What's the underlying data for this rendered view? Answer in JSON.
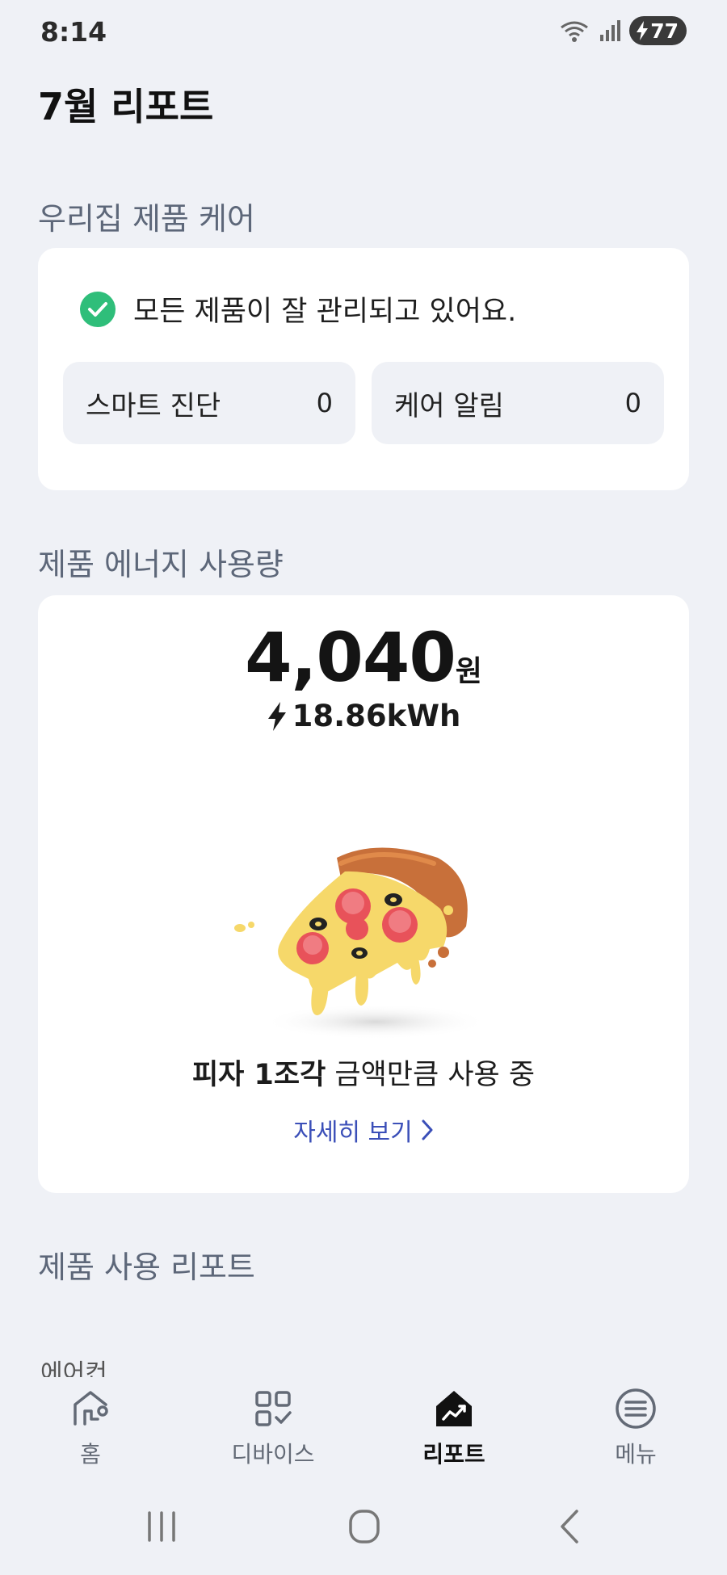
{
  "status_bar": {
    "time": "8:14",
    "battery": "77"
  },
  "page_title": "7월 리포트",
  "care_section": {
    "title": "우리집 제품 케어",
    "status_text": "모든 제품이 잘 관리되고 있어요.",
    "tiles": [
      {
        "label": "스마트 진단",
        "count": "0"
      },
      {
        "label": "케어 알림",
        "count": "0"
      }
    ]
  },
  "energy_section": {
    "title": "제품 에너지 사용량",
    "cost_amount": "4,040",
    "cost_unit": "원",
    "kwh": "18.86kWh",
    "compare_bold": "피자 1조각",
    "compare_rest": " 금액만큼 사용 중",
    "detail_link": "자세히 보기"
  },
  "usage_section": {
    "title": "제품 사용 리포트",
    "first_item": "에어컨"
  },
  "bottom_nav": [
    {
      "label": "홈",
      "icon": "home-icon"
    },
    {
      "label": "디바이스",
      "icon": "devices-icon"
    },
    {
      "label": "리포트",
      "icon": "report-icon",
      "active": true
    },
    {
      "label": "메뉴",
      "icon": "menu-icon"
    }
  ],
  "colors": {
    "accent_link": "#3b4fb8",
    "check_green": "#2fbe7a",
    "background": "#eff1f6"
  }
}
